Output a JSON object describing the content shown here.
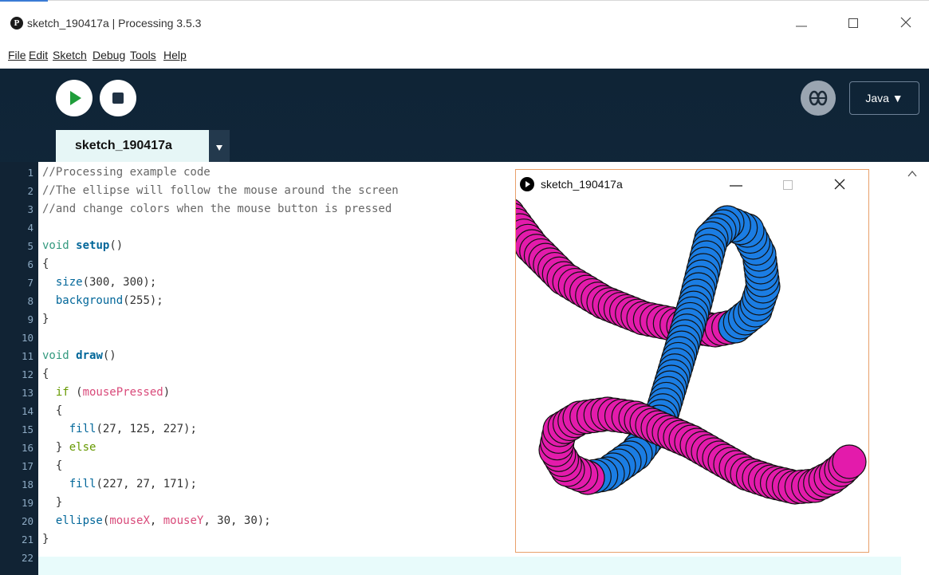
{
  "window": {
    "title": "sketch_190417a | Processing 3.5.3",
    "app_icon_glyph": "P"
  },
  "menu": [
    "File",
    "Edit",
    "Sketch",
    "Debug",
    "Tools",
    "Help"
  ],
  "toolbar": {
    "mode_label": "Java ▼",
    "icons": [
      "run-icon",
      "stop-icon",
      "debugger-icon"
    ]
  },
  "tab": {
    "label": "sketch_190417a"
  },
  "editor": {
    "lines": [
      [
        [
          "c",
          "//Processing example code"
        ]
      ],
      [
        [
          "c",
          "//The ellipse will follow the mouse around the screen"
        ]
      ],
      [
        [
          "c",
          "//and change colors when the mouse button is pressed"
        ]
      ],
      [],
      [
        [
          "k",
          "void "
        ],
        [
          "f",
          "setup"
        ],
        [
          "p",
          "()"
        ]
      ],
      [
        [
          "p",
          "{"
        ]
      ],
      [
        [
          "p",
          "  "
        ],
        [
          "a",
          "size"
        ],
        [
          "p",
          "(300, 300);"
        ]
      ],
      [
        [
          "p",
          "  "
        ],
        [
          "a",
          "background"
        ],
        [
          "p",
          "(255);"
        ]
      ],
      [
        [
          "p",
          "}"
        ]
      ],
      [],
      [
        [
          "k",
          "void "
        ],
        [
          "f",
          "draw"
        ],
        [
          "p",
          "()"
        ]
      ],
      [
        [
          "p",
          "{"
        ]
      ],
      [
        [
          "p",
          "  "
        ],
        [
          "d",
          "if"
        ],
        [
          "p",
          " ("
        ],
        [
          "v",
          "mousePressed"
        ],
        [
          "p",
          ")"
        ]
      ],
      [
        [
          "p",
          "  {"
        ]
      ],
      [
        [
          "p",
          "    "
        ],
        [
          "a",
          "fill"
        ],
        [
          "p",
          "(27, 125, 227);"
        ]
      ],
      [
        [
          "p",
          "  } "
        ],
        [
          "d",
          "else"
        ]
      ],
      [
        [
          "p",
          "  {"
        ]
      ],
      [
        [
          "p",
          "    "
        ],
        [
          "a",
          "fill"
        ],
        [
          "p",
          "(227, 27, 171);"
        ]
      ],
      [
        [
          "p",
          "  }"
        ]
      ],
      [
        [
          "p",
          "  "
        ],
        [
          "a",
          "ellipse"
        ],
        [
          "p",
          "("
        ],
        [
          "v",
          "mouseX"
        ],
        [
          "p",
          ", "
        ],
        [
          "v",
          "mouseY"
        ],
        [
          "p",
          ", 30, 30);"
        ]
      ],
      [
        [
          "p",
          "}"
        ]
      ],
      []
    ]
  },
  "sketch_window": {
    "title": "sketch_190417a",
    "colors": {
      "blue": "#1b7de3",
      "pink": "#e31bab"
    }
  }
}
